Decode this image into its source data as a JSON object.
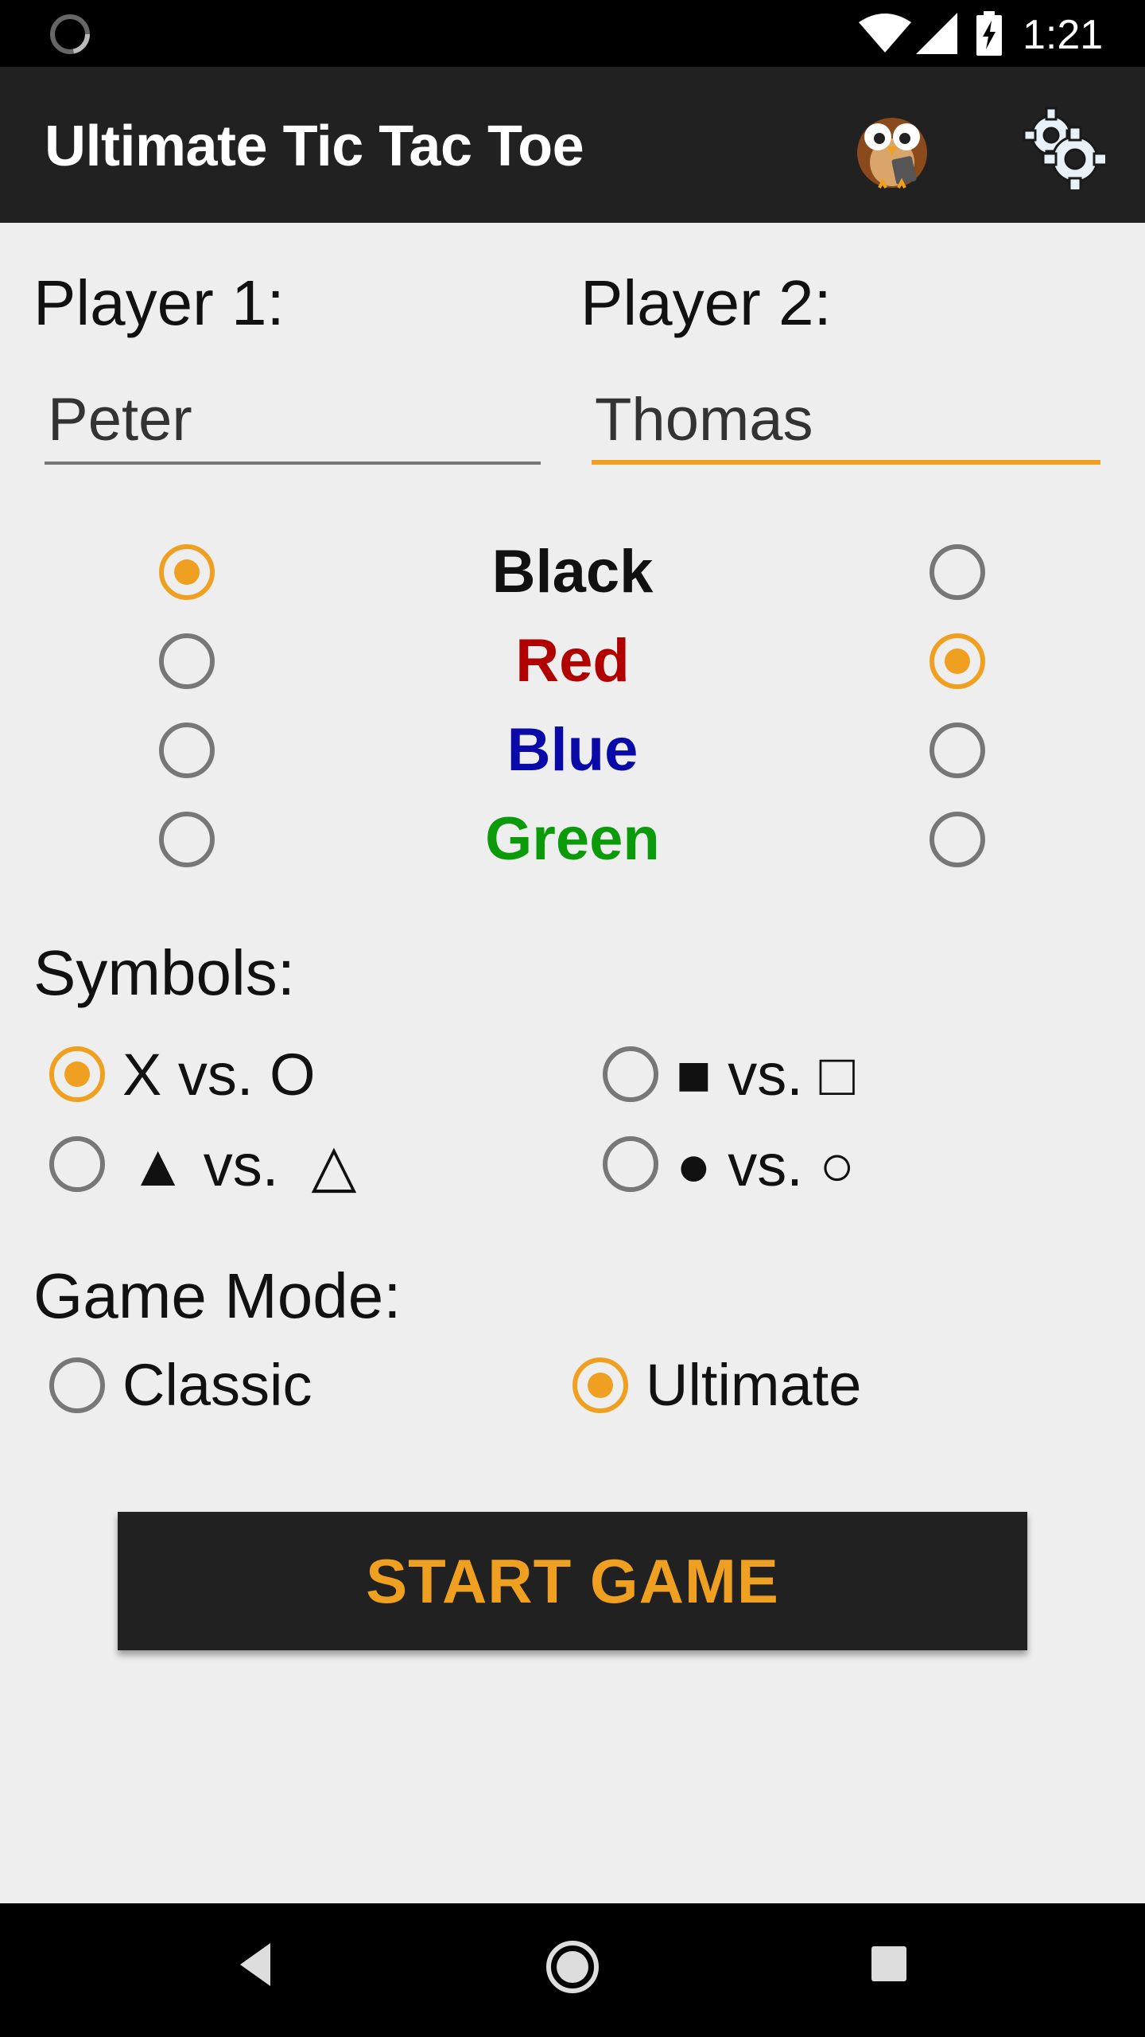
{
  "status_bar": {
    "time": "1:21",
    "icons": [
      "loading-spinner-icon",
      "wifi-icon",
      "cell-signal-icon",
      "battery-charging-icon"
    ]
  },
  "app_bar": {
    "title": "Ultimate Tic Tac Toe",
    "icons": [
      "owl-logo-icon",
      "settings-gear-icon"
    ]
  },
  "players": {
    "p1_label": "Player 1:",
    "p2_label": "Player 2:",
    "p1_name": "Peter",
    "p2_name": "Thomas"
  },
  "colors": {
    "options": [
      {
        "name": "Black",
        "hex": "#111111",
        "p1_selected": true,
        "p2_selected": false
      },
      {
        "name": "Red",
        "hex": "#b00000",
        "p1_selected": false,
        "p2_selected": true
      },
      {
        "name": "Blue",
        "hex": "#0a0aa8",
        "p1_selected": false,
        "p2_selected": false
      },
      {
        "name": "Green",
        "hex": "#0a9a0a",
        "p1_selected": false,
        "p2_selected": false
      }
    ]
  },
  "symbols": {
    "label": "Symbols:",
    "options": [
      {
        "label": "X vs. O",
        "selected": true
      },
      {
        "label": "■ vs. □",
        "selected": false
      },
      {
        "label": "▲ vs.  △",
        "selected": false
      },
      {
        "label": "● vs. ○",
        "selected": false
      }
    ]
  },
  "game_mode": {
    "label": "Game Mode:",
    "options": [
      {
        "label": "Classic",
        "selected": false
      },
      {
        "label": "Ultimate",
        "selected": true
      }
    ]
  },
  "start_button": {
    "label": "START GAME"
  },
  "accent_color": "#f0a020"
}
